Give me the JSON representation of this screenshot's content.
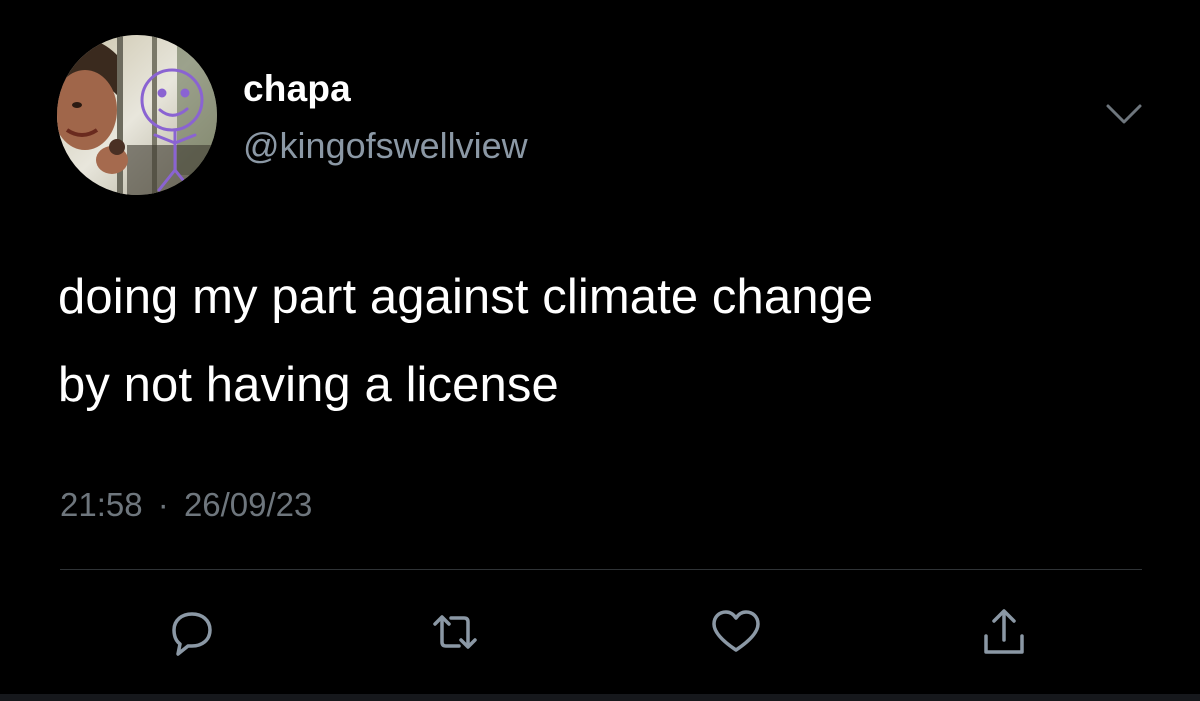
{
  "user": {
    "display_name": "chapa",
    "handle": "@kingofswellview"
  },
  "tweet": {
    "lines": [
      "doing my part against climate change",
      "by not having a license"
    ],
    "time": "21:58",
    "separator": "·",
    "date": "26/09/23"
  },
  "actions": [
    {
      "icon": "reply-icon"
    },
    {
      "icon": "retweet-icon"
    },
    {
      "icon": "like-icon"
    },
    {
      "icon": "share-icon"
    }
  ],
  "colors": {
    "background": "#000000",
    "text": "#ffffff",
    "secondary_text": "#8b98a5",
    "icon": "#8b98a5",
    "divider": "#2f3336",
    "avatar_doodle": "#8a63d2"
  }
}
